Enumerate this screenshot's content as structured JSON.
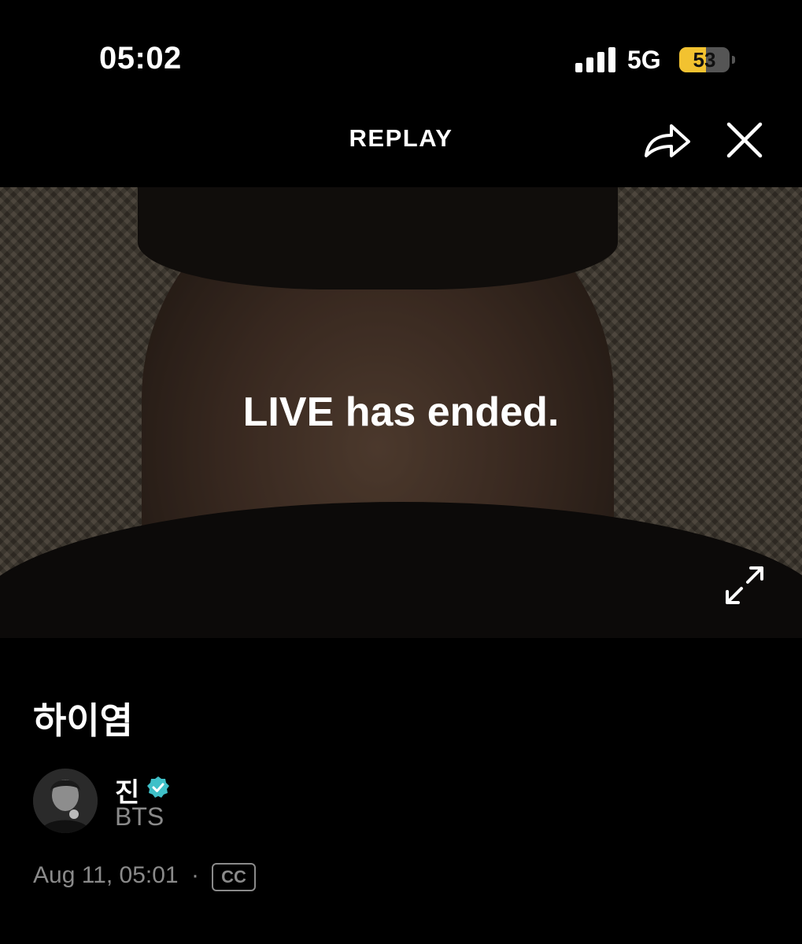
{
  "status_bar": {
    "time": "05:02",
    "network": "5G",
    "battery_level": 53,
    "battery_text": "53",
    "signal_icon": "signal-bars-icon"
  },
  "header": {
    "title": "REPLAY",
    "share_icon": "share-icon",
    "close_icon": "close-icon"
  },
  "video": {
    "message": "LIVE has ended.",
    "expand_icon": "expand-icon"
  },
  "stream": {
    "title": "하이염",
    "channel_name": "진",
    "channel_group": "BTS",
    "verified_icon": "verified-badge-icon",
    "date_time": "Aug 11, 05:01",
    "separator": "·",
    "cc_label": "CC"
  },
  "colors": {
    "background": "#000000",
    "battery_accent": "#f2c230",
    "verified_accent": "#3fc0c8",
    "muted_text": "#8a8a8a"
  }
}
